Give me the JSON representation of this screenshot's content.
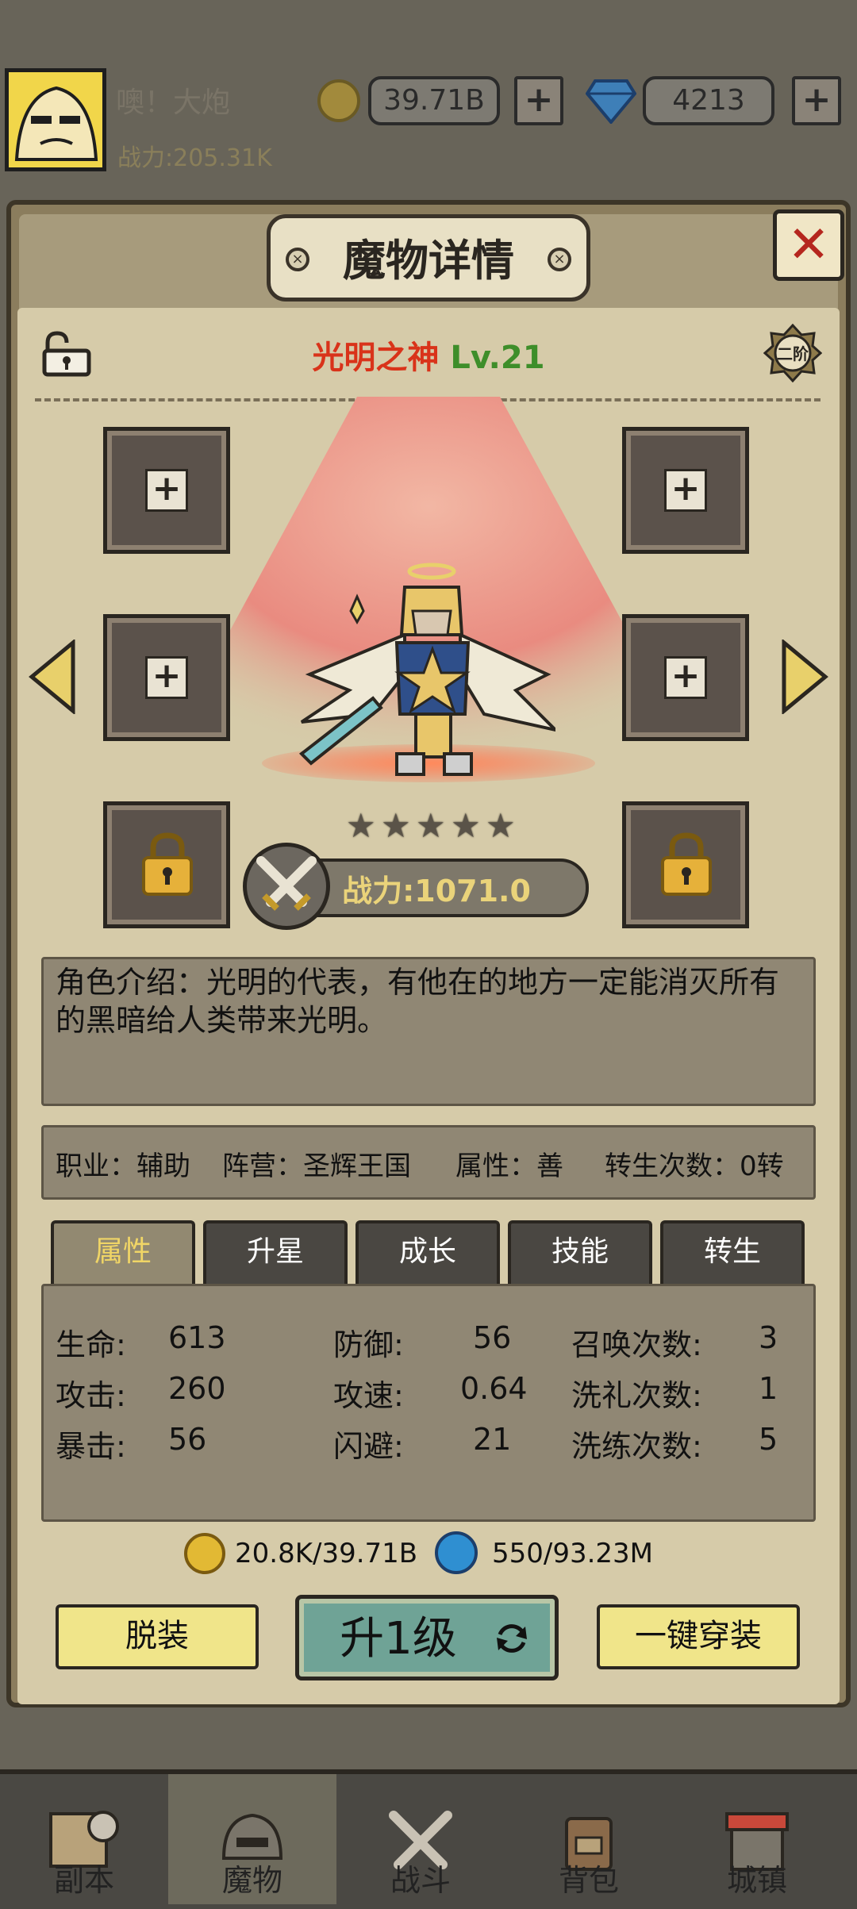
{
  "player": {
    "name": "噢！大炮",
    "power": "战力:205.31K"
  },
  "currency": {
    "gold": "39.71B",
    "gems": "4213"
  },
  "dialog": {
    "title": "魔物详情",
    "close": "✕"
  },
  "hero": {
    "name": "光明之神",
    "level": "Lv.21",
    "rank": "二阶",
    "stars": 5,
    "power": "战力:1071.0",
    "description": "角色介绍：光明的代表，有他在的地方一定能消灭所有的黑暗给人类带来光明。"
  },
  "info": {
    "job": "职业：辅助",
    "camp": "阵营：圣辉王国",
    "attr": "属性：善",
    "rebirth": "转生次数：0转"
  },
  "tabs": [
    "属性",
    "升星",
    "成长",
    "技能",
    "转生"
  ],
  "stats": {
    "hp_label": "生命:",
    "hp": "613",
    "atk_label": "攻击:",
    "atk": "260",
    "crit_label": "暴击:",
    "crit": "56",
    "def_label": "防御:",
    "def": "56",
    "aspd_label": "攻速:",
    "aspd": "0.64",
    "dodge_label": "闪避:",
    "dodge": "21",
    "summon_label": "召唤次数:",
    "summon": "3",
    "baptism_label": "洗礼次数:",
    "baptism": "1",
    "refine_label": "洗练次数:",
    "refine": "5"
  },
  "cost": {
    "gold": "20.8K/39.71B",
    "essence": "550/93.23M"
  },
  "actions": {
    "unequip": "脱装",
    "levelup": "升1级",
    "equip_all": "一键穿装"
  },
  "nav": [
    "副本",
    "魔物",
    "战斗",
    "背包",
    "城镇"
  ],
  "colors": {
    "name": "#d9331a",
    "level": "#3e8e2a",
    "power": "#ead37a",
    "button": "#f0e58a"
  }
}
